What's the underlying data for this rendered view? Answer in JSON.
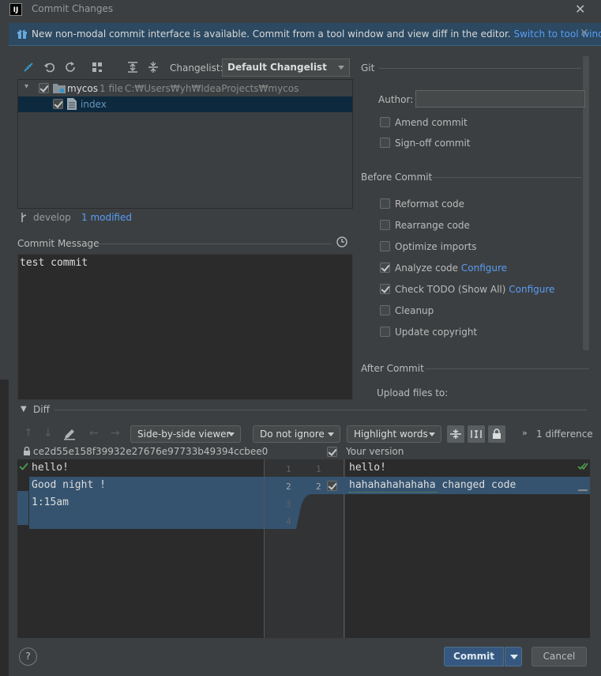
{
  "window": {
    "title": "Commit Changes",
    "logo": "IJ"
  },
  "banner": {
    "text": "New non-modal commit interface is available. Commit from a tool window and view diff in the editor.",
    "link": "Switch to tool window"
  },
  "toolbar": {
    "changelist_label": "Changelist:",
    "changelist_value": "Default Changelist"
  },
  "tree": {
    "root": {
      "name": "mycos",
      "count": "1 file",
      "path": "C:₩Users₩yh₩IdeaProjects₩mycos"
    },
    "child": {
      "name": "index"
    }
  },
  "branch": {
    "name": "develop",
    "status": "1 modified"
  },
  "commit_message": {
    "label": "Commit Message",
    "value": "test commit"
  },
  "git": {
    "title": "Git",
    "author_label": "Author:",
    "author_value": "",
    "amend": "Amend commit",
    "signoff": "Sign-off commit"
  },
  "before_commit": {
    "title": "Before Commit",
    "reformat": "Reformat code",
    "rearrange": "Rearrange code",
    "optimize": "Optimize imports",
    "analyze": "Analyze code",
    "analyze_link": "Configure",
    "todo": "Check TODO (Show All)",
    "todo_link": "Configure",
    "cleanup": "Cleanup",
    "copyright": "Update copyright"
  },
  "after_commit": {
    "title": "After Commit",
    "upload_label": "Upload files to:"
  },
  "diff": {
    "title": "Diff",
    "viewer": "Side-by-side viewer",
    "ignore": "Do not ignore",
    "highlight": "Highlight words",
    "differences": "1 difference",
    "left_title": "ce2d55e158f39932e27676e97733b49394ccbee0",
    "right_title": "Your version",
    "left_lines": [
      "hello!",
      "Good night !",
      "1:15am",
      ""
    ],
    "left_nums": [
      "1",
      "2",
      "3",
      "4"
    ],
    "right_lines": [
      "hello!",
      "hahahahahahaha changed code"
    ],
    "right_nums": [
      "1",
      "2"
    ]
  },
  "footer": {
    "help": "?",
    "commit": "Commit",
    "cancel": "Cancel"
  },
  "colors": {
    "accent": "#589df6",
    "selection": "#2d4a6b",
    "changed": "#35536f",
    "primary_button": "#365880"
  }
}
